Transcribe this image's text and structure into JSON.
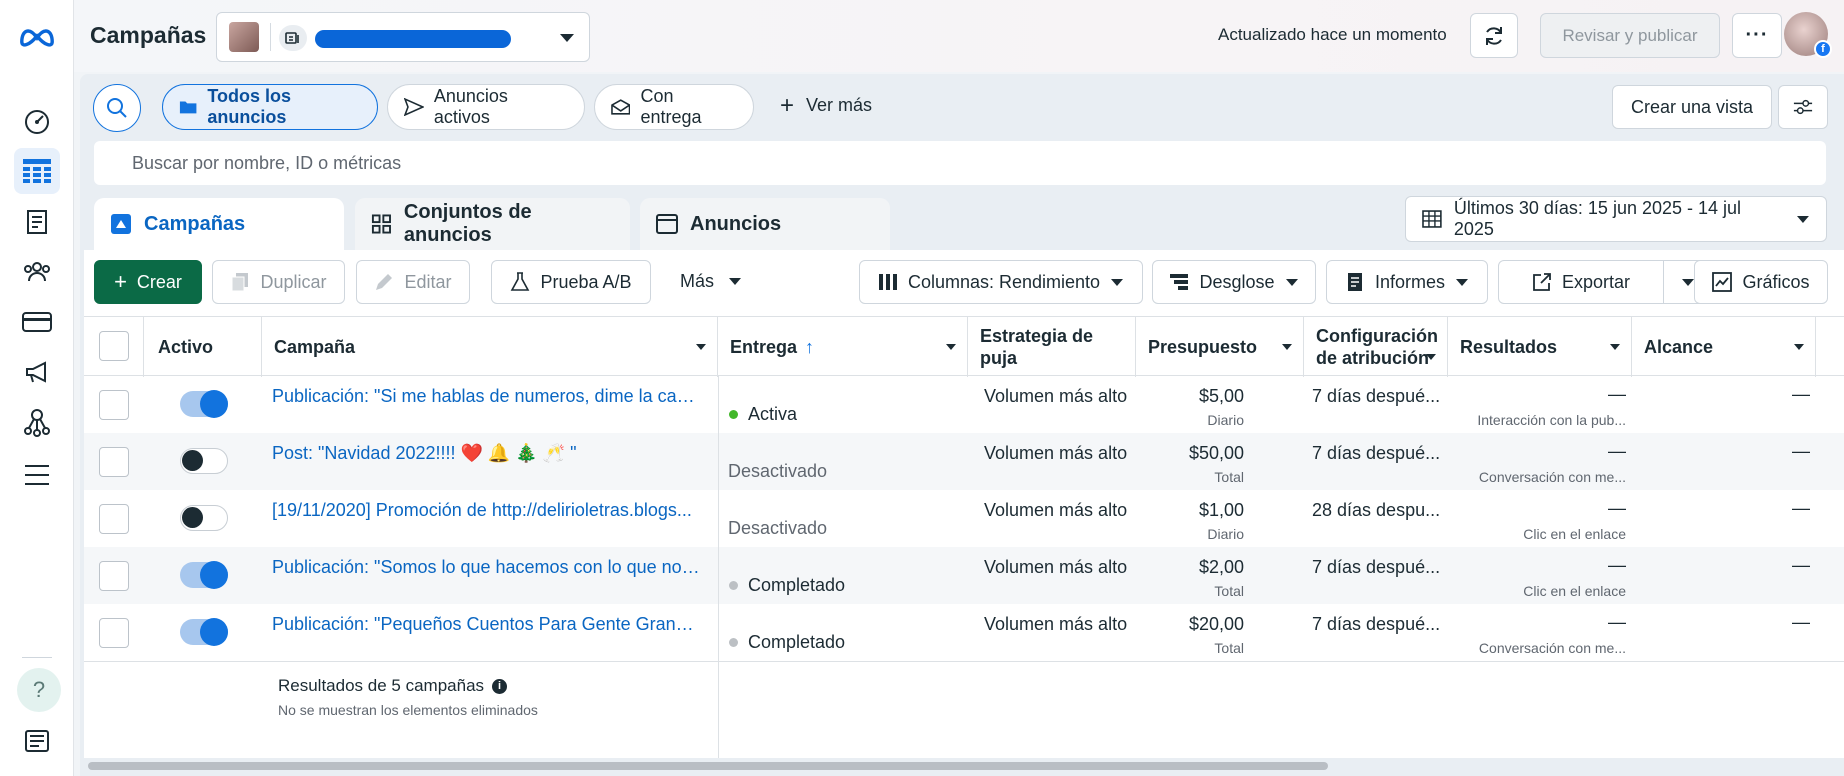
{
  "header": {
    "title": "Campañas",
    "updated": "Actualizado hace un momento",
    "publish": "Revisar y publicar"
  },
  "filters": {
    "all_ads": "Todos los anuncios",
    "active_ads": "Anuncios activos",
    "with_delivery": "Con entrega",
    "see_more": "Ver más",
    "create_view": "Crear una vista",
    "search_placeholder": "Buscar por nombre, ID o métricas"
  },
  "tabs": [
    {
      "label": "Campañas"
    },
    {
      "label": "Conjuntos de anuncios"
    },
    {
      "label": "Anuncios"
    }
  ],
  "date_range": "Últimos 30 días: 15 jun 2025 - 14 jul 2025",
  "toolbar": {
    "create": "Crear",
    "duplicate": "Duplicar",
    "edit": "Editar",
    "ab_test": "Prueba A/B",
    "more": "Más",
    "columns": "Columnas: Rendimiento",
    "breakdown": "Desglose",
    "reports": "Informes",
    "export": "Exportar",
    "charts": "Gráficos"
  },
  "table": {
    "headers": {
      "active": "Activo",
      "campaign": "Campaña",
      "delivery": "Entrega",
      "bid1": "Estrategia de",
      "bid2": "puja",
      "budget": "Presupuesto",
      "attr1": "Configuración",
      "attr2": "de atribución",
      "results": "Resultados",
      "reach": "Alcance"
    },
    "rows": [
      {
        "name": "Publicación: \"Si me hablas de numeros, dime la canti...",
        "on": true,
        "delivery": "Activa",
        "delivery_color": "#42b72a",
        "bid": "Volumen más alto",
        "budget": "$5,00",
        "budget_type": "Diario",
        "attribution": "7 días despué...",
        "results": "—",
        "results_sub": "Interacción con la pub...",
        "reach": "—"
      },
      {
        "name": "Post: \"Navidad 2022!!!! ❤️ 🔔 🎄 🥂 \"",
        "on": false,
        "delivery": "Desactivado",
        "delivery_color": "",
        "bid": "Volumen más alto",
        "budget": "$50,00",
        "budget_type": "Total",
        "attribution": "7 días despué...",
        "results": "—",
        "results_sub": "Conversación con me...",
        "reach": "—"
      },
      {
        "name": "[19/11/2020] Promoción de http://delirioletras.blogs...",
        "on": false,
        "delivery": "Desactivado",
        "delivery_color": "",
        "bid": "Volumen más alto",
        "budget": "$1,00",
        "budget_type": "Diario",
        "attribution": "28 días despu...",
        "results": "—",
        "results_sub": "Clic en el enlace",
        "reach": "—"
      },
      {
        "name": "Publicación: \"Somos lo que hacemos con lo que nos ...",
        "on": true,
        "delivery": "Completado",
        "delivery_color": "#bcc0c4",
        "bid": "Volumen más alto",
        "budget": "$2,00",
        "budget_type": "Total",
        "attribution": "7 días despué...",
        "results": "—",
        "results_sub": "Clic en el enlace",
        "reach": "—"
      },
      {
        "name": "Publicación: \"Pequeños Cuentos Para Gente Grande\"",
        "on": true,
        "delivery": "Completado",
        "delivery_color": "#bcc0c4",
        "bid": "Volumen más alto",
        "budget": "$20,00",
        "budget_type": "Total",
        "attribution": "7 días despué...",
        "results": "—",
        "results_sub": "Conversación con me...",
        "reach": "—"
      }
    ],
    "footer": "Resultados de 5 campañas",
    "footer_sub": "No se muestran los elementos eliminados"
  }
}
